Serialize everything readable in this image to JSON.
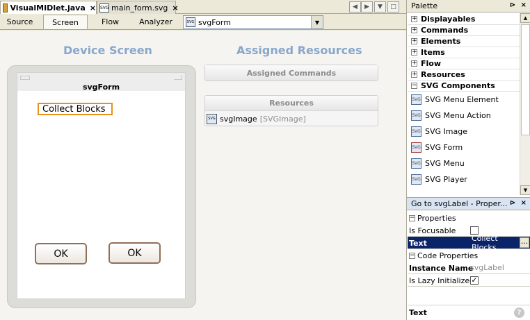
{
  "file_tabs": [
    {
      "label": "VisualMIDlet.java",
      "icon": "java-file-icon",
      "active": true
    },
    {
      "label": "main_form.svg",
      "icon": "svg-file-icon",
      "active": false
    }
  ],
  "view_tabs": [
    "Source",
    "Screen",
    "Flow",
    "Analyzer"
  ],
  "active_view": "Screen",
  "form_select": {
    "value": "svgForm"
  },
  "canvas": {
    "device_title": "Device Screen",
    "resources_title": "Assigned Resources",
    "screen_title": "svgForm",
    "label_text": "Collect Blocks",
    "ok_left": "OK",
    "ok_right": "OK",
    "assigned_commands": "Assigned Commands",
    "resources_header": "Resources",
    "resource_item": {
      "name": "svgImage",
      "type": "[SVGImage]"
    }
  },
  "palette": {
    "title": "Palette",
    "categories": [
      "Displayables",
      "Commands",
      "Elements",
      "Items",
      "Flow",
      "Resources"
    ],
    "expanded": "SVG Components",
    "items": [
      "SVG Menu Element",
      "SVG Menu Action",
      "SVG Image",
      "SVG Form",
      "SVG Menu",
      "SVG Player"
    ]
  },
  "properties": {
    "title": "Go to svgLabel - Proper...",
    "group1": "Properties",
    "is_focusable_label": "Is Focusable",
    "is_focusable": false,
    "text_label": "Text",
    "text_value": "Collect Blocks",
    "text_button": "...",
    "group2": "Code Properties",
    "instance_name_label": "Instance Name",
    "instance_name": "svgLabel",
    "lazy_label": "Is Lazy Initialized",
    "lazy_checked": true,
    "lazy_mark": "✓",
    "footer": "Text",
    "help": "?"
  },
  "colors": {
    "accent_title": "#88a7cc",
    "selection": "#0a246a",
    "highlight": "#e8901a"
  }
}
